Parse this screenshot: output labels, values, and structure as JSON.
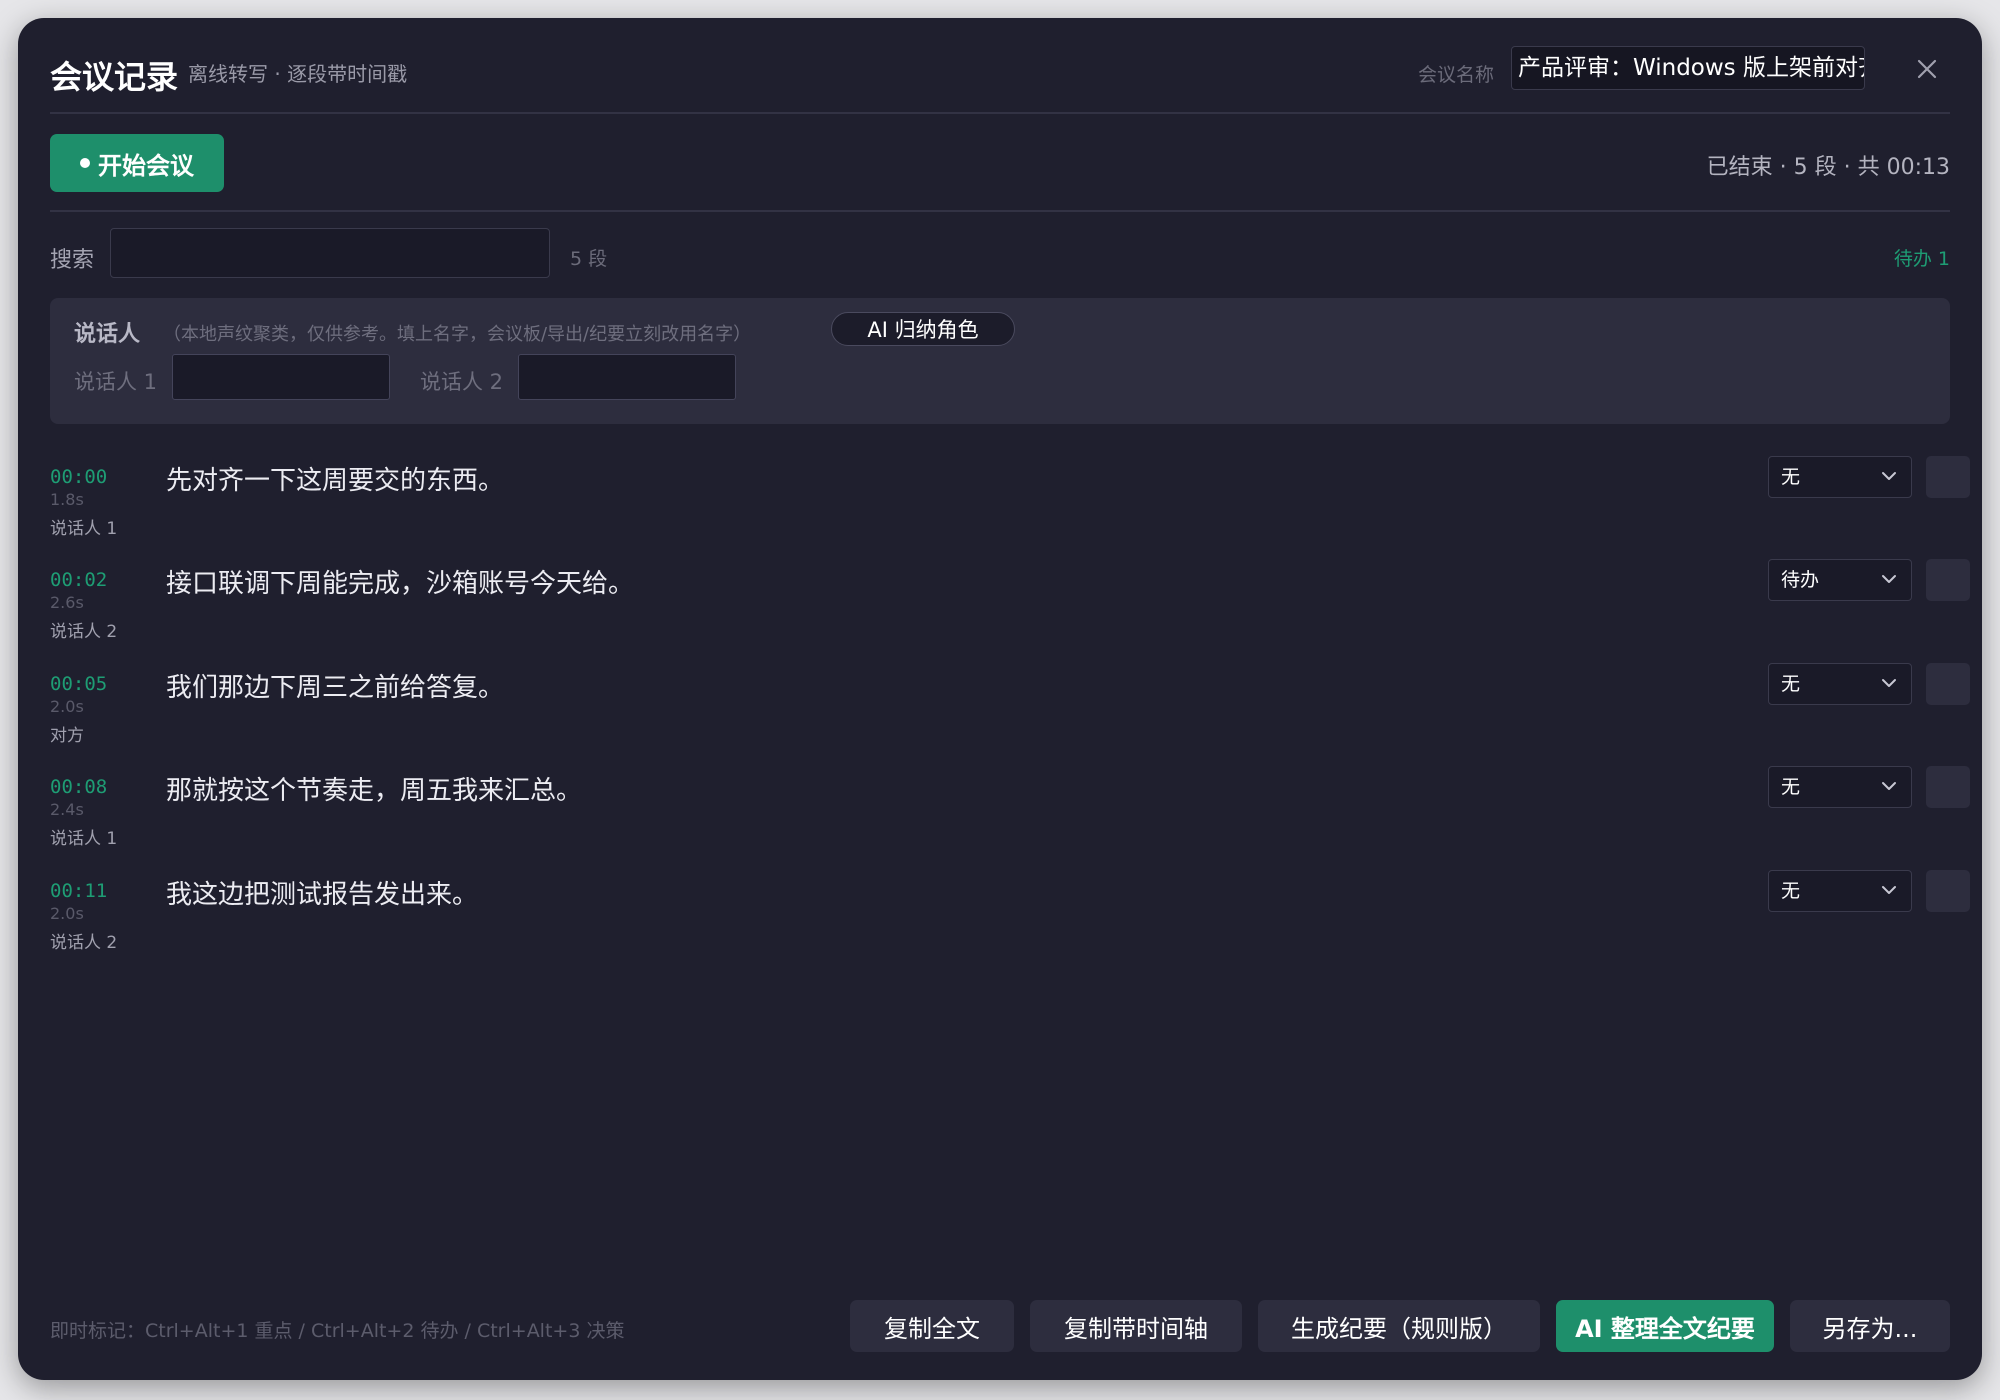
{
  "header": {
    "title": "会议记录",
    "subtitle": "离线转写 · 逐段带时间戳",
    "meeting_name_label": "会议名称",
    "meeting_name_value": "产品评审：Windows 版上架前对齐"
  },
  "toolbar": {
    "start_label": "开始会议",
    "status": "已结束 · 5 段 · 共 00:13"
  },
  "search": {
    "label": "搜索",
    "placeholder": "",
    "count": "5 段",
    "todo_count": "待办 1"
  },
  "speakers": {
    "title": "说话人",
    "note": "（本地声纹聚类，仅供参考。填上名字，会议板/导出/纪要立刻改用名字）",
    "ai_button": "AI 归纳角色",
    "items": [
      {
        "label": "说话人 1",
        "value": ""
      },
      {
        "label": "说话人 2",
        "value": ""
      }
    ]
  },
  "segments": [
    {
      "time": "00:00",
      "duration": "1.8s",
      "speaker": "说话人 1",
      "text": "先对齐一下这周要交的东西。",
      "tag": "无"
    },
    {
      "time": "00:02",
      "duration": "2.6s",
      "speaker": "说话人 2",
      "text": "接口联调下周能完成，沙箱账号今天给。",
      "tag": "待办"
    },
    {
      "time": "00:05",
      "duration": "2.0s",
      "speaker": "对方",
      "text": "我们那边下周三之前给答复。",
      "tag": "无"
    },
    {
      "time": "00:08",
      "duration": "2.4s",
      "speaker": "说话人 1",
      "text": "那就按这个节奏走，周五我来汇总。",
      "tag": "无"
    },
    {
      "time": "00:11",
      "duration": "2.0s",
      "speaker": "说话人 2",
      "text": "我这边把测试报告发出来。",
      "tag": "无"
    }
  ],
  "footer": {
    "hint": "即时标记：Ctrl+Alt+1 重点 / Ctrl+Alt+2 待办 / Ctrl+Alt+3 决策",
    "copy_all": "复制全文",
    "copy_timeline": "复制带时间轴",
    "gen_summary": "生成纪要（规则版）",
    "ai_summary": "AI 整理全文纪要",
    "save_as": "另存为..."
  },
  "colors": {
    "accent": "#1e8f6b",
    "timestamp": "#1e9d74",
    "background": "#1f1f2e"
  }
}
